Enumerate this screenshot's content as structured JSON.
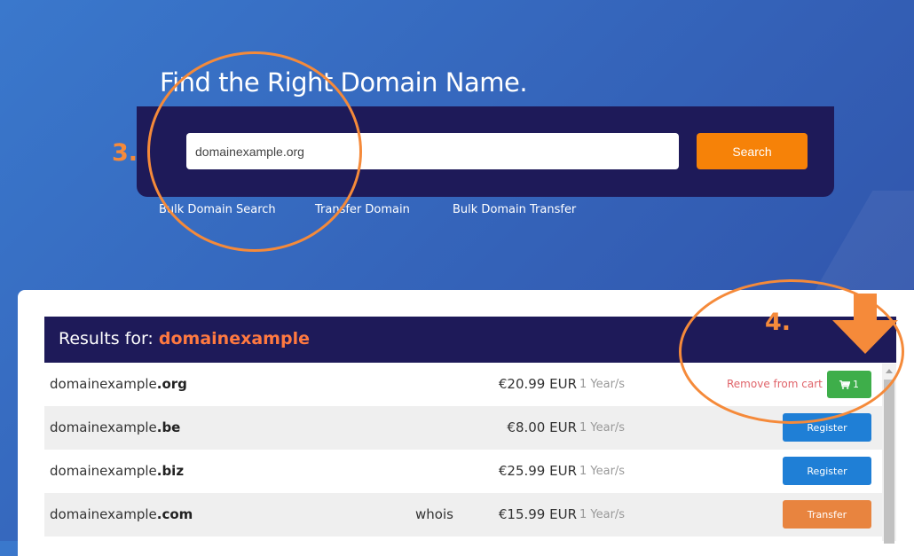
{
  "hero": {
    "title": "Find the Right Domain Name."
  },
  "search": {
    "input_value": "domainexample.org",
    "button_label": "Search"
  },
  "sub_links": [
    {
      "label": "Bulk Domain Search"
    },
    {
      "label": "Transfer Domain"
    },
    {
      "label": "Bulk Domain Transfer"
    }
  ],
  "annotations": {
    "step3": "3.",
    "step4": "4.",
    "color": "#f58a3a"
  },
  "results": {
    "prefix": "Results for:",
    "query": "domainexample",
    "rows": [
      {
        "name": "domainexample",
        "tld": ".org",
        "whois": "",
        "price": "€20.99 EUR",
        "period": "1 Year/s",
        "action": "in-cart",
        "remove_label": "Remove from cart",
        "cart_count": "1"
      },
      {
        "name": "domainexample",
        "tld": ".be",
        "whois": "",
        "price": "€8.00 EUR",
        "period": "1 Year/s",
        "action": "register",
        "button_label": "Register"
      },
      {
        "name": "domainexample",
        "tld": ".biz",
        "whois": "",
        "price": "€25.99 EUR",
        "period": "1 Year/s",
        "action": "register",
        "button_label": "Register"
      },
      {
        "name": "domainexample",
        "tld": ".com",
        "whois": "whois",
        "price": "€15.99 EUR",
        "period": "1 Year/s",
        "action": "transfer",
        "button_label": "Transfer"
      }
    ]
  },
  "colors": {
    "background": "#3565bb",
    "panel": "#1e1a59",
    "search_button": "#f68208",
    "query_highlight": "#ff7940",
    "register_button": "#1f7fd6",
    "transfer_button": "#e8843f",
    "cart_button": "#3eae4a",
    "remove_link": "#e0646a"
  }
}
